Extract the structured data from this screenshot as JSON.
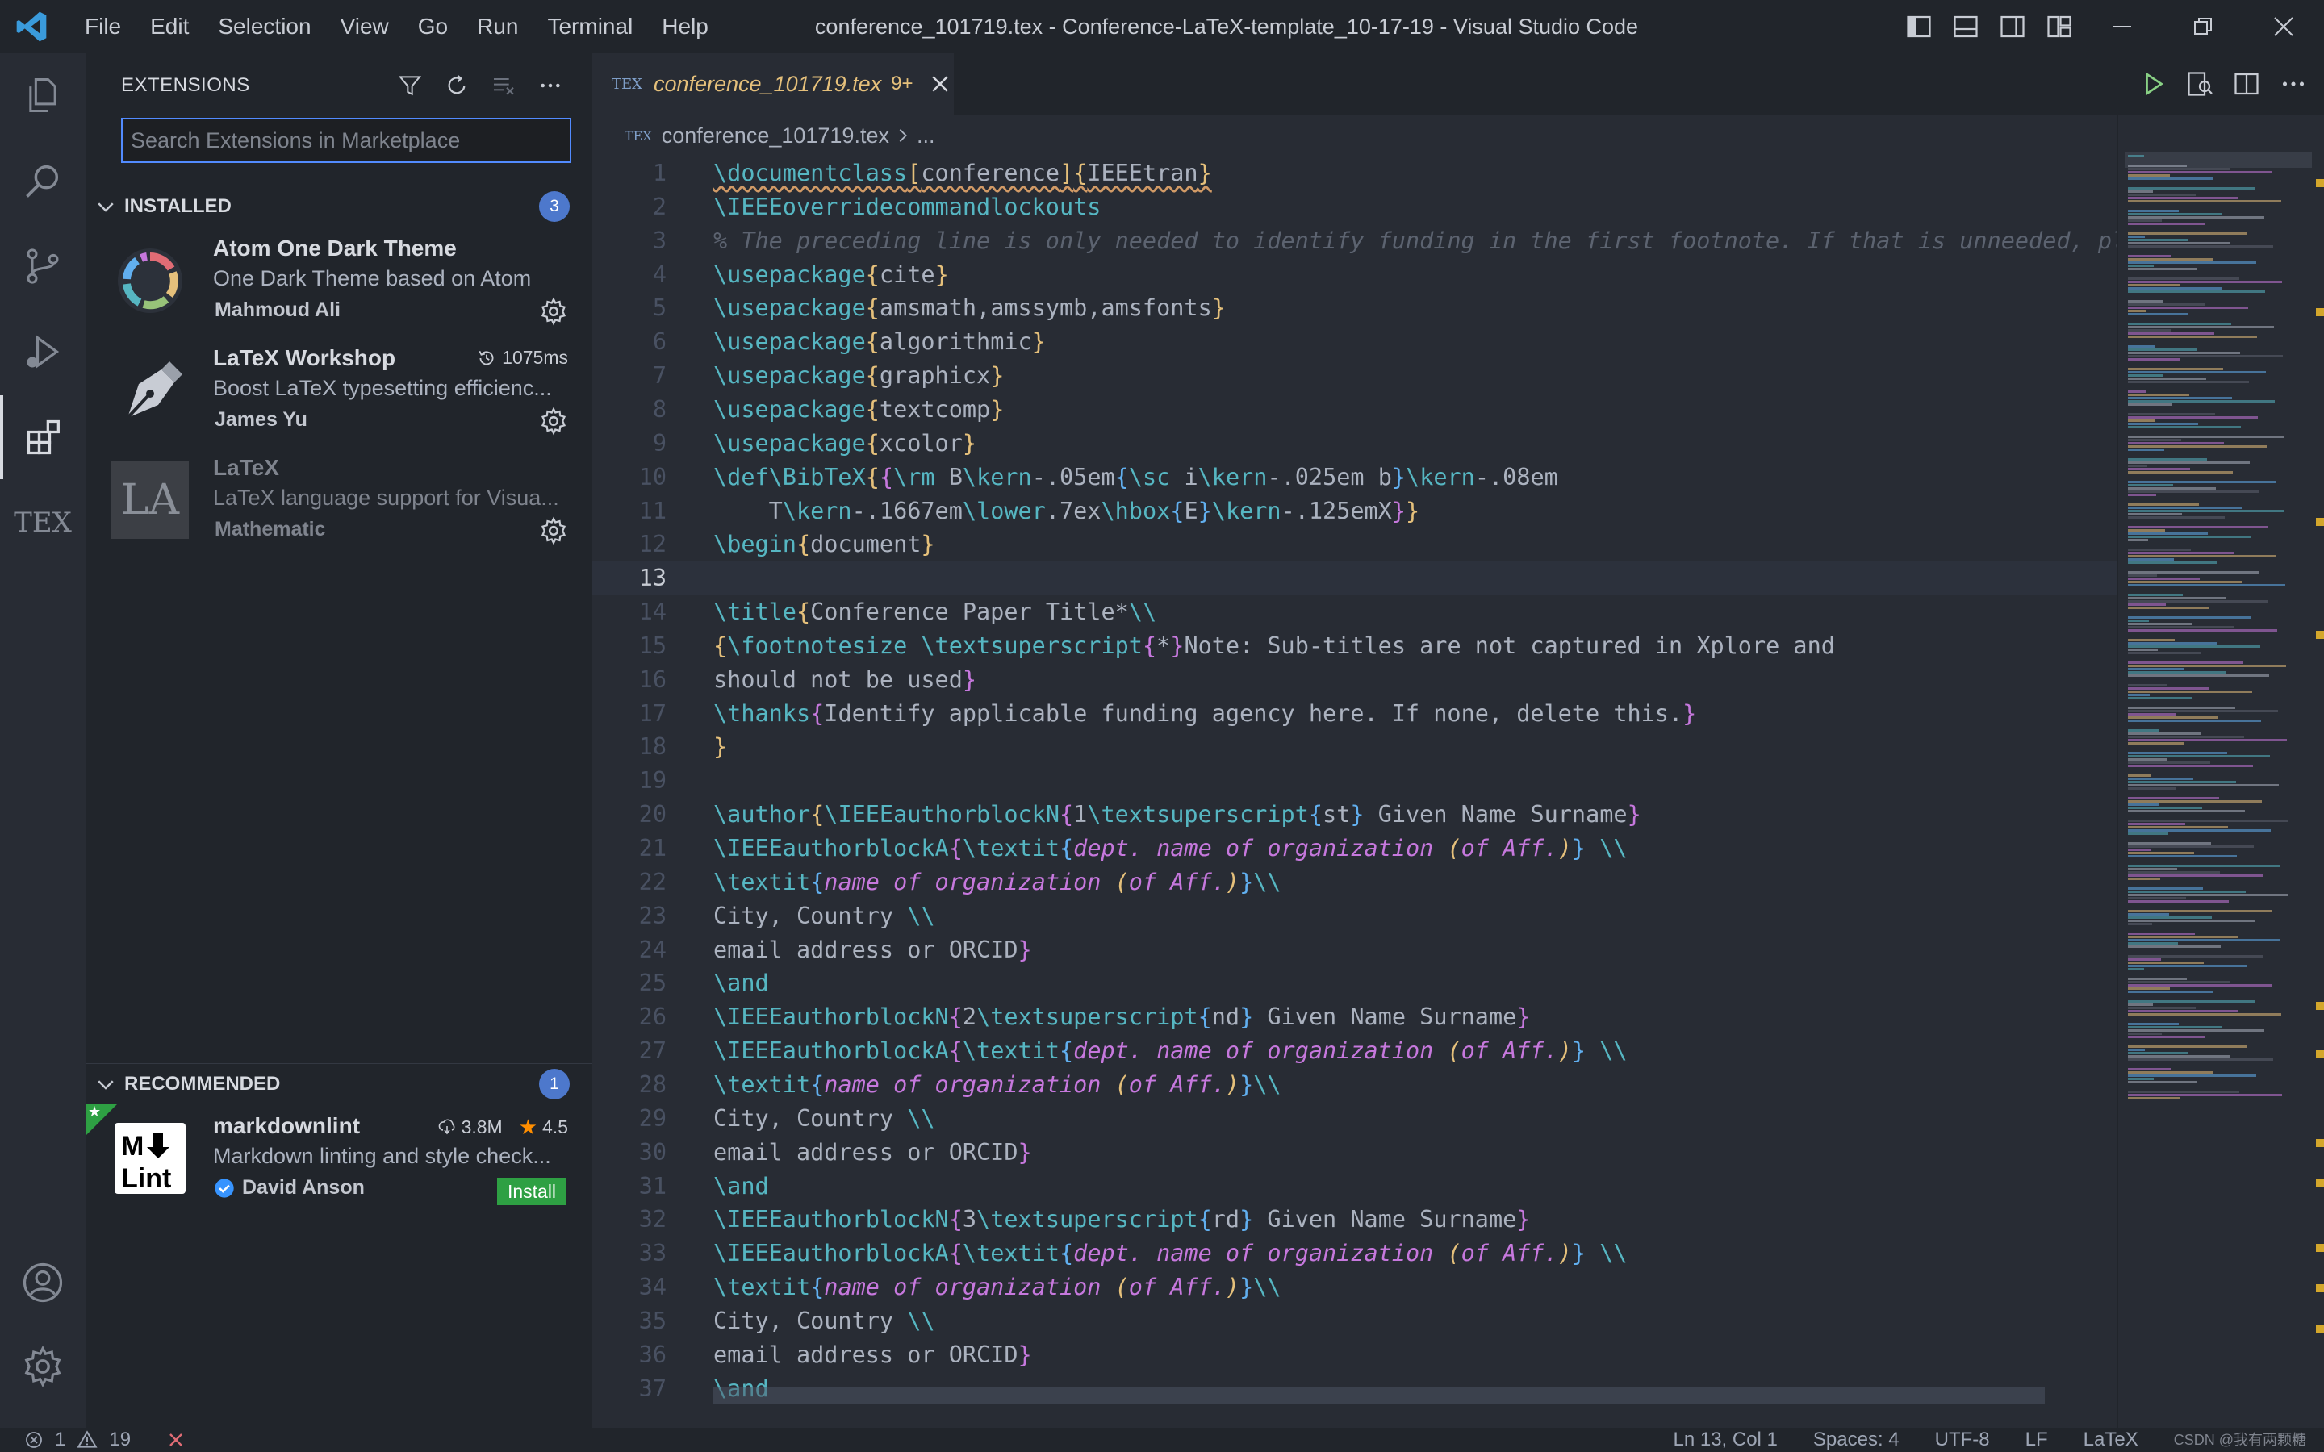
{
  "titlebar": {
    "menu": [
      "File",
      "Edit",
      "Selection",
      "View",
      "Go",
      "Run",
      "Terminal",
      "Help"
    ],
    "title": "conference_101719.tex - Conference-LaTeX-template_10-17-19 - Visual Studio Code"
  },
  "activity": {
    "items": [
      "explorer-icon",
      "search-icon",
      "source-control-icon",
      "run-debug-icon",
      "extensions-icon",
      "tex-icon"
    ],
    "tex_label": "TEX",
    "bottom": [
      "account-icon",
      "manage-gear-icon"
    ]
  },
  "sidebar": {
    "title": "EXTENSIONS",
    "search_placeholder": "Search Extensions in Marketplace",
    "installed": {
      "label": "INSTALLED",
      "count": "3",
      "items": [
        {
          "name": "Atom One Dark Theme",
          "description": "One Dark Theme based on Atom",
          "author": "Mahmoud Ali"
        },
        {
          "name": "LaTeX Workshop",
          "description": "Boost LaTeX typesetting efficienc...",
          "author": "James Yu",
          "meta": "1075ms"
        },
        {
          "name": "LaTeX",
          "description": "LaTeX language support for Visua...",
          "author": "Mathematic",
          "icon_text": "LA"
        }
      ]
    },
    "recommended": {
      "label": "RECOMMENDED",
      "count": "1",
      "items": [
        {
          "name": "markdownlint",
          "description": "Markdown linting and style check...",
          "author": "David Anson",
          "downloads": "3.8M",
          "rating": "4.5",
          "action": "Install"
        }
      ]
    }
  },
  "editor": {
    "tab_label": "conference_101719.tex",
    "tab_problems": "9+",
    "tab_icon_text": "TEX",
    "breadcrumb_file": "conference_101719.tex",
    "breadcrumb_more": "...",
    "current_line": 13,
    "line_numbers": [
      "1",
      "2",
      "3",
      "4",
      "5",
      "6",
      "7",
      "8",
      "9",
      "10",
      "11",
      "12",
      "13",
      "14",
      "15",
      "16",
      "17",
      "18",
      "19",
      "20",
      "21",
      "22",
      "23",
      "24",
      "25",
      "26",
      "27",
      "28",
      "29",
      "30",
      "31",
      "32",
      "33",
      "34",
      "35",
      "36",
      "37"
    ],
    "lines": [
      [
        [
          "kw sq",
          "\\documentclass"
        ],
        [
          "br sq",
          "["
        ],
        [
          "tx sq",
          "conference"
        ],
        [
          "br sq",
          "]"
        ],
        [
          "br sq",
          "{"
        ],
        [
          "tx sq",
          "IEEEtran"
        ],
        [
          "br sq",
          "}"
        ]
      ],
      [
        [
          "kw",
          "\\IEEEoverridecommandlockouts"
        ]
      ],
      [
        [
          "cm",
          "% The preceding line is only needed to identify funding in the first footnote. If that is unneeded, ple"
        ]
      ],
      [
        [
          "kw",
          "\\usepackage"
        ],
        [
          "br",
          "{"
        ],
        [
          "tx",
          "cite"
        ],
        [
          "br",
          "}"
        ]
      ],
      [
        [
          "kw",
          "\\usepackage"
        ],
        [
          "br",
          "{"
        ],
        [
          "tx",
          "amsmath,amssymb,amsfonts"
        ],
        [
          "br",
          "}"
        ]
      ],
      [
        [
          "kw",
          "\\usepackage"
        ],
        [
          "br",
          "{"
        ],
        [
          "tx",
          "algorithmic"
        ],
        [
          "br",
          "}"
        ]
      ],
      [
        [
          "kw",
          "\\usepackage"
        ],
        [
          "br",
          "{"
        ],
        [
          "tx",
          "graphicx"
        ],
        [
          "br",
          "}"
        ]
      ],
      [
        [
          "kw",
          "\\usepackage"
        ],
        [
          "br",
          "{"
        ],
        [
          "tx",
          "textcomp"
        ],
        [
          "br",
          "}"
        ]
      ],
      [
        [
          "kw",
          "\\usepackage"
        ],
        [
          "br",
          "{"
        ],
        [
          "tx",
          "xcolor"
        ],
        [
          "br",
          "}"
        ]
      ],
      [
        [
          "kw",
          "\\def\\BibTeX"
        ],
        [
          "br",
          "{"
        ],
        [
          "bp",
          "{"
        ],
        [
          "kw",
          "\\rm"
        ],
        [
          "tx",
          " B"
        ],
        [
          "kw",
          "\\kern"
        ],
        [
          "tx",
          "-.05em"
        ],
        [
          "bb",
          "{"
        ],
        [
          "kw",
          "\\sc"
        ],
        [
          "tx",
          " i"
        ],
        [
          "kw",
          "\\kern"
        ],
        [
          "tx",
          "-.025em b"
        ],
        [
          "bb",
          "}"
        ],
        [
          "kw",
          "\\kern"
        ],
        [
          "tx",
          "-.08em"
        ]
      ],
      [
        [
          "tx",
          "    T"
        ],
        [
          "kw",
          "\\kern"
        ],
        [
          "tx",
          "-.1667em"
        ],
        [
          "kw",
          "\\lower"
        ],
        [
          "tx",
          ".7ex"
        ],
        [
          "kw",
          "\\hbox"
        ],
        [
          "bb",
          "{"
        ],
        [
          "tx",
          "E"
        ],
        [
          "bb",
          "}"
        ],
        [
          "kw",
          "\\kern"
        ],
        [
          "tx",
          "-.125emX"
        ],
        [
          "bp",
          "}"
        ],
        [
          "br",
          "}"
        ]
      ],
      [
        [
          "kw",
          "\\begin"
        ],
        [
          "br",
          "{"
        ],
        [
          "tx",
          "document"
        ],
        [
          "br",
          "}"
        ]
      ],
      [],
      [
        [
          "kw",
          "\\title"
        ],
        [
          "br",
          "{"
        ],
        [
          "tx",
          "Conference Paper Title*"
        ],
        [
          "kw",
          "\\\\"
        ]
      ],
      [
        [
          "br",
          "{"
        ],
        [
          "kw",
          "\\footnotesize \\textsuperscript"
        ],
        [
          "bp",
          "{"
        ],
        [
          "tx",
          "*"
        ],
        [
          "bp",
          "}"
        ],
        [
          "tx",
          "Note: Sub-titles are not captured in Xplore and"
        ]
      ],
      [
        [
          "tx",
          "should not be used"
        ],
        [
          "bp",
          "}"
        ]
      ],
      [
        [
          "kw",
          "\\thanks"
        ],
        [
          "bp",
          "{"
        ],
        [
          "tx",
          "Identify applicable funding agency here. If none, delete this."
        ],
        [
          "bp",
          "}"
        ]
      ],
      [
        [
          "br",
          "}"
        ]
      ],
      [],
      [
        [
          "kw",
          "\\author"
        ],
        [
          "br",
          "{"
        ],
        [
          "kw",
          "\\IEEEauthorblockN"
        ],
        [
          "bp",
          "{"
        ],
        [
          "tx",
          "1"
        ],
        [
          "kw",
          "\\textsuperscript"
        ],
        [
          "bb",
          "{"
        ],
        [
          "tx",
          "st"
        ],
        [
          "bb",
          "}"
        ],
        [
          "tx",
          " Given Name Surname"
        ],
        [
          "bp",
          "}"
        ]
      ],
      [
        [
          "kw",
          "\\IEEEauthorblockA"
        ],
        [
          "bp",
          "{"
        ],
        [
          "kw",
          "\\textit"
        ],
        [
          "bb",
          "{"
        ],
        [
          "it",
          "dept. name of organization "
        ],
        [
          "itb",
          "("
        ],
        [
          "it",
          "of Aff."
        ],
        [
          "itb",
          ")"
        ],
        [
          "bb",
          "}"
        ],
        [
          "tx",
          " "
        ],
        [
          "kw",
          "\\\\"
        ]
      ],
      [
        [
          "kw",
          "\\textit"
        ],
        [
          "bb",
          "{"
        ],
        [
          "it",
          "name of organization "
        ],
        [
          "itb",
          "("
        ],
        [
          "it",
          "of Aff."
        ],
        [
          "itb",
          ")"
        ],
        [
          "bb",
          "}"
        ],
        [
          "kw",
          "\\\\"
        ]
      ],
      [
        [
          "tx",
          "City, Country "
        ],
        [
          "kw",
          "\\\\"
        ]
      ],
      [
        [
          "tx",
          "email address or ORCID"
        ],
        [
          "bp",
          "}"
        ]
      ],
      [
        [
          "kw",
          "\\and"
        ]
      ],
      [
        [
          "kw",
          "\\IEEEauthorblockN"
        ],
        [
          "bp",
          "{"
        ],
        [
          "tx",
          "2"
        ],
        [
          "kw",
          "\\textsuperscript"
        ],
        [
          "bb",
          "{"
        ],
        [
          "tx",
          "nd"
        ],
        [
          "bb",
          "}"
        ],
        [
          "tx",
          " Given Name Surname"
        ],
        [
          "bp",
          "}"
        ]
      ],
      [
        [
          "kw",
          "\\IEEEauthorblockA"
        ],
        [
          "bp",
          "{"
        ],
        [
          "kw",
          "\\textit"
        ],
        [
          "bb",
          "{"
        ],
        [
          "it",
          "dept. name of organization "
        ],
        [
          "itb",
          "("
        ],
        [
          "it",
          "of Aff."
        ],
        [
          "itb",
          ")"
        ],
        [
          "bb",
          "}"
        ],
        [
          "tx",
          " "
        ],
        [
          "kw",
          "\\\\"
        ]
      ],
      [
        [
          "kw",
          "\\textit"
        ],
        [
          "bb",
          "{"
        ],
        [
          "it",
          "name of organization "
        ],
        [
          "itb",
          "("
        ],
        [
          "it",
          "of Aff."
        ],
        [
          "itb",
          ")"
        ],
        [
          "bb",
          "}"
        ],
        [
          "kw",
          "\\\\"
        ]
      ],
      [
        [
          "tx",
          "City, Country "
        ],
        [
          "kw",
          "\\\\"
        ]
      ],
      [
        [
          "tx",
          "email address or ORCID"
        ],
        [
          "bp",
          "}"
        ]
      ],
      [
        [
          "kw",
          "\\and"
        ]
      ],
      [
        [
          "kw",
          "\\IEEEauthorblockN"
        ],
        [
          "bp",
          "{"
        ],
        [
          "tx",
          "3"
        ],
        [
          "kw",
          "\\textsuperscript"
        ],
        [
          "bb",
          "{"
        ],
        [
          "tx",
          "rd"
        ],
        [
          "bb",
          "}"
        ],
        [
          "tx",
          " Given Name Surname"
        ],
        [
          "bp",
          "}"
        ]
      ],
      [
        [
          "kw",
          "\\IEEEauthorblockA"
        ],
        [
          "bp",
          "{"
        ],
        [
          "kw",
          "\\textit"
        ],
        [
          "bb",
          "{"
        ],
        [
          "it",
          "dept. name of organization "
        ],
        [
          "itb",
          "("
        ],
        [
          "it",
          "of Aff."
        ],
        [
          "itb",
          ")"
        ],
        [
          "bb",
          "}"
        ],
        [
          "tx",
          " "
        ],
        [
          "kw",
          "\\\\"
        ]
      ],
      [
        [
          "kw",
          "\\textit"
        ],
        [
          "bb",
          "{"
        ],
        [
          "it",
          "name of organization "
        ],
        [
          "itb",
          "("
        ],
        [
          "it",
          "of Aff."
        ],
        [
          "itb",
          ")"
        ],
        [
          "bb",
          "}"
        ],
        [
          "kw",
          "\\\\"
        ]
      ],
      [
        [
          "tx",
          "City, Country "
        ],
        [
          "kw",
          "\\\\"
        ]
      ],
      [
        [
          "tx",
          "email address or ORCID"
        ],
        [
          "bp",
          "}"
        ]
      ],
      [
        [
          "kw",
          "\\and"
        ]
      ]
    ]
  },
  "statusbar": {
    "errors": "1",
    "warnings": "19",
    "position": "Ln 13, Col 1",
    "spaces": "Spaces: 4",
    "encoding": "UTF-8",
    "eol": "LF",
    "language": "LaTeX",
    "watermark": "CSDN @我有两颗糖"
  },
  "colors": {
    "accent": "#528bff",
    "badge": "#4d78cc",
    "install": "#2ea043",
    "tab_modified": "#e5c07b",
    "error": "#e06c75"
  }
}
